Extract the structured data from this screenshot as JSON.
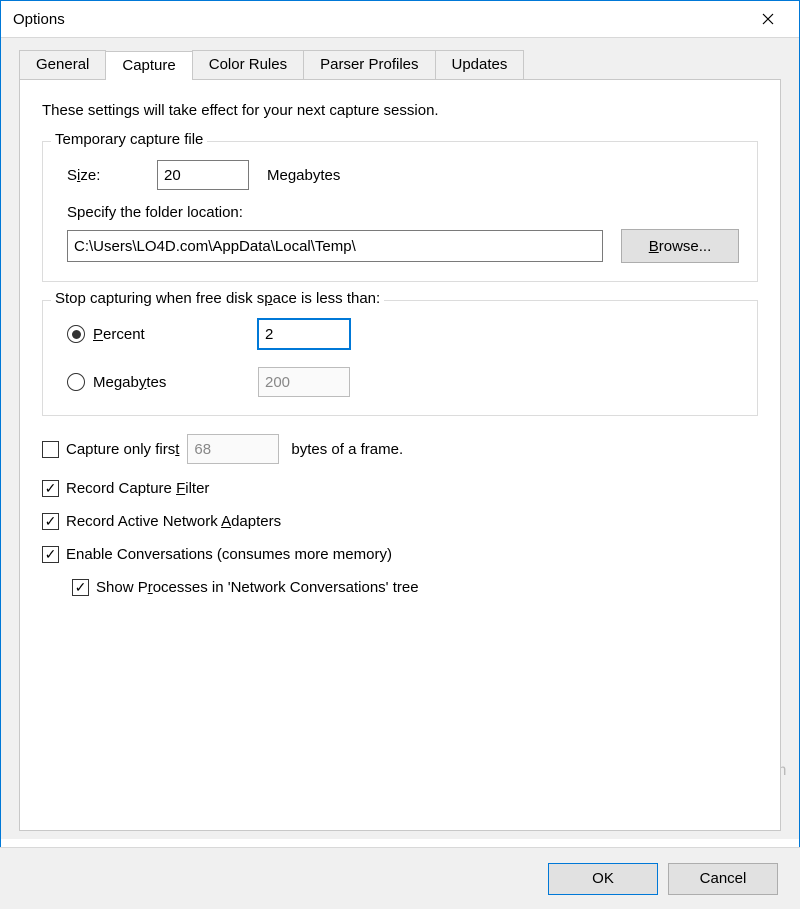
{
  "window": {
    "title": "Options"
  },
  "tabs": {
    "general": "General",
    "capture": "Capture",
    "color_rules": "Color Rules",
    "parser_profiles": "Parser Profiles",
    "updates": "Updates"
  },
  "intro": "These settings will take effect for your next capture session.",
  "tempfile": {
    "group_title": "Temporary capture file",
    "size_label_pre": "S",
    "size_label_u": "i",
    "size_label_post": "ze:",
    "size_value": "20",
    "size_unit": "Megabytes",
    "folder_label": "Specify the folder location:",
    "folder_value": "C:\\Users\\LO4D.com\\AppData\\Local\\Temp\\",
    "browse_pre": "",
    "browse_u": "B",
    "browse_post": "rowse..."
  },
  "stop": {
    "group_title_pre": "Stop capturing when free disk s",
    "group_title_u": "p",
    "group_title_post": "ace is less than:",
    "percent_u": "P",
    "percent_post": "ercent",
    "percent_value": "2",
    "mb_pre": "Megab",
    "mb_u": "y",
    "mb_post": "tes",
    "mb_value": "200"
  },
  "capture_first": {
    "label_pre": "Capture only firs",
    "label_u": "t",
    "value": "68",
    "suffix": "bytes of a frame."
  },
  "record_filter": {
    "pre": "Record Capture ",
    "u": "F",
    "post": "ilter"
  },
  "record_adapters": {
    "pre": "Record Active Network ",
    "u": "A",
    "post": "dapters"
  },
  "enable_conv": "Enable Conversations (consumes more memory)",
  "show_proc": {
    "pre": "Show P",
    "u": "r",
    "post": "ocesses in 'Network Conversations' tree"
  },
  "buttons": {
    "ok": "OK",
    "cancel": "Cancel"
  },
  "watermark": "LO4D.com"
}
